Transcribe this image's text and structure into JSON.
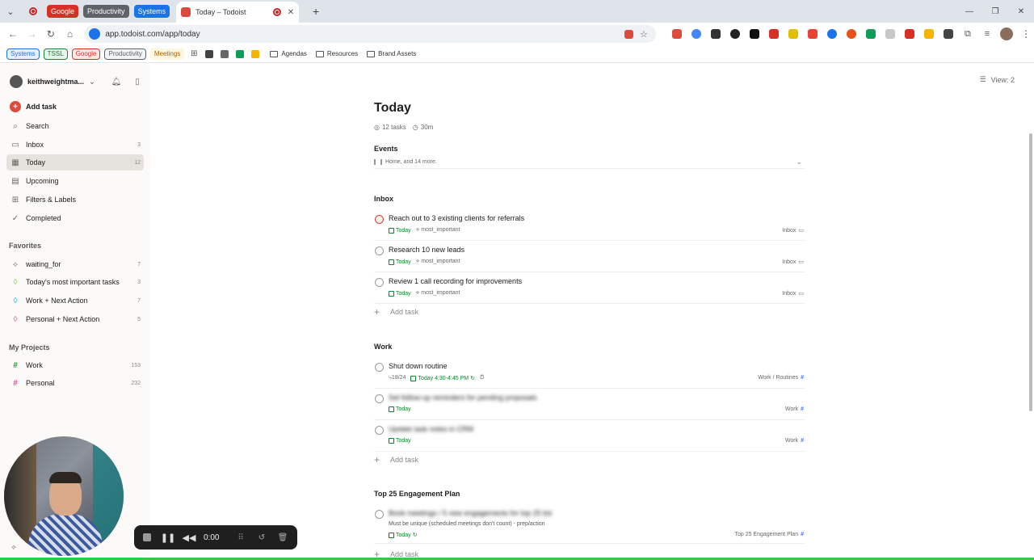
{
  "browser": {
    "tab_groups": [
      {
        "label": "Google",
        "color": "#d93025"
      },
      {
        "label": "Productivity",
        "color": "#5f6368"
      },
      {
        "label": "Systems",
        "color": "#1a73e8"
      }
    ],
    "active_tab_title": "Today – Todoist",
    "url": "app.todoist.com/app/today",
    "bookmarks_chips": [
      {
        "label": "Systems",
        "color": "#1a73e8",
        "bg": "#e8f0fe"
      },
      {
        "label": "TSSL",
        "color": "#188038",
        "bg": "#e6f4ea"
      },
      {
        "label": "Google",
        "color": "#d93025",
        "bg": "#fce8e6"
      },
      {
        "label": "Productivity",
        "color": "#5f6368",
        "bg": "#f1f3f4"
      },
      {
        "label": "Meetings",
        "color": "#b06000",
        "bg": "#fef7e0"
      }
    ],
    "bookmark_folders": [
      "Agendas",
      "Resources",
      "Brand Assets"
    ]
  },
  "sidebar": {
    "username": "keithweightma...",
    "add_task": "Add task",
    "nav": [
      {
        "label": "Search",
        "count": "",
        "icon": "search-icon"
      },
      {
        "label": "Inbox",
        "count": "3",
        "icon": "inbox-icon"
      },
      {
        "label": "Today",
        "count": "12",
        "icon": "calendar-today-icon"
      },
      {
        "label": "Upcoming",
        "count": "",
        "icon": "calendar-upcoming-icon"
      },
      {
        "label": "Filters & Labels",
        "count": "",
        "icon": "grid-icon"
      },
      {
        "label": "Completed",
        "count": "",
        "icon": "check-circle-icon"
      }
    ],
    "favorites_heading": "Favorites",
    "favorites": [
      {
        "label": "waiting_for",
        "count": "7",
        "color": "#808080"
      },
      {
        "label": "Today's most important tasks",
        "count": "3",
        "color": "#7ecc49"
      },
      {
        "label": "Work + Next Action",
        "count": "7",
        "color": "#14aaf5"
      },
      {
        "label": "Personal + Next Action",
        "count": "5",
        "color": "#e05194"
      }
    ],
    "projects_heading": "My Projects",
    "projects": [
      {
        "label": "Work",
        "count": "153",
        "color": "#299438"
      },
      {
        "label": "Personal",
        "count": "232",
        "color": "#e05194"
      }
    ]
  },
  "view_label": "View: 2",
  "main": {
    "title": "Today",
    "task_count": "12 tasks",
    "duration": "30m",
    "events_heading": "Events",
    "events_summary": "Home, and 14 more.",
    "inbox_heading": "Inbox",
    "inbox_tasks": [
      {
        "title": "Reach out to 3 existing clients for referrals",
        "date": "Today",
        "label": "most_important",
        "project": "Inbox",
        "priority": true
      },
      {
        "title": "Research 10 new leads",
        "date": "Today",
        "label": "most_important",
        "project": "Inbox",
        "priority": false
      },
      {
        "title": "Review 1 call recording for improvements",
        "date": "Today",
        "label": "most_important",
        "project": "Inbox",
        "priority": false
      }
    ],
    "add_task_label": "Add task",
    "work_heading": "Work",
    "work_tasks": [
      {
        "title": "Shut down routine",
        "subtasks": "18/24",
        "date": "Today 4:30-4:45 PM",
        "project": "Work / Routines"
      },
      {
        "title": "Set follow-up reminders for pending proposals",
        "date": "Today",
        "project": "Work"
      },
      {
        "title": "Update task notes in CRM",
        "date": "Today",
        "project": "Work"
      }
    ],
    "engagement_heading": "Top 25 Engagement Plan",
    "engagement_tasks": [
      {
        "title": "Book meetings / 5 new engagements for top 25 list",
        "description": "Must be unique (scheduled meetings don't count) - prep/action",
        "date": "Today",
        "project": "Top 25 Engagement Plan"
      }
    ]
  },
  "recorder": {
    "time": "0:00"
  }
}
